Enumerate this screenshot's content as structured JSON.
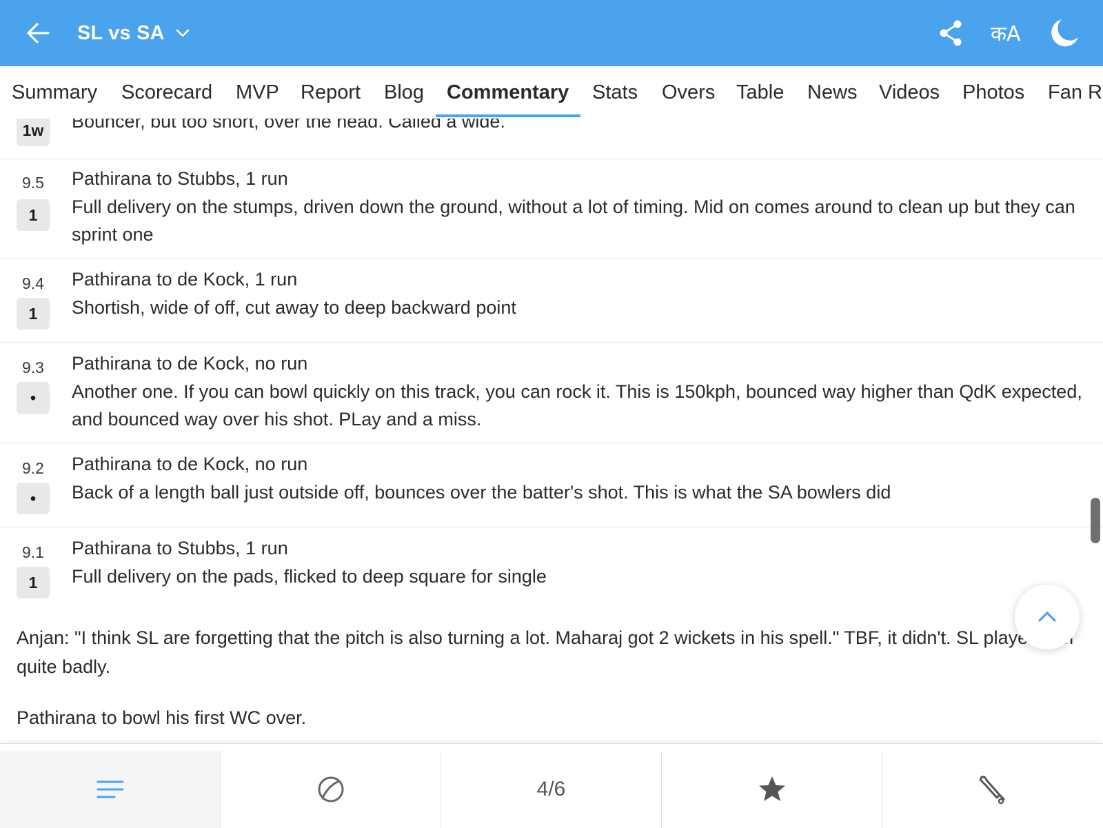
{
  "header": {
    "title": "SL vs SA",
    "icons": [
      "arrow-left-icon",
      "chevron-down-icon",
      "share-icon",
      "language-icon",
      "moon-icon"
    ],
    "background_color": "#4aa3ec",
    "lang_label": "कA"
  },
  "tabs": [
    {
      "label": "Summary"
    },
    {
      "label": "Scorecard"
    },
    {
      "label": "MVP"
    },
    {
      "label": "Report"
    },
    {
      "label": "Blog"
    },
    {
      "label": "Commentary",
      "active": true
    },
    {
      "label": "Stats"
    },
    {
      "label": "Overs"
    },
    {
      "label": "Table"
    },
    {
      "label": "News"
    },
    {
      "label": "Videos"
    },
    {
      "label": "Photos"
    },
    {
      "label": "Fan Ra"
    }
  ],
  "commentary": [
    {
      "badge": "1w",
      "desc": "Bouncer, but too short, over the head. Called a wide."
    },
    {
      "over": "9.5",
      "badge": "1",
      "headline": "Pathirana to Stubbs, 1 run",
      "desc": "Full delivery on the stumps, driven down the ground, without a lot of timing. Mid on comes around to clean up but they can sprint one"
    },
    {
      "over": "9.4",
      "badge": "1",
      "headline": "Pathirana to de Kock, 1 run",
      "desc": "Shortish, wide of off, cut away to deep backward point"
    },
    {
      "over": "9.3",
      "badge": "•",
      "headline": "Pathirana to de Kock, no run",
      "desc": "Another one. If you can bowl quickly on this track, you can rock it. This is 150kph, bounced way higher than QdK expected, and bounced way over his shot. PLay and a miss."
    },
    {
      "over": "9.2",
      "badge": "•",
      "headline": "Pathirana to de Kock, no run",
      "desc": "Back of a length ball just outside off, bounces over the batter's shot. This is what the SA bowlers did"
    },
    {
      "over": "9.1",
      "badge": "1",
      "headline": "Pathirana to Stubbs, 1 run",
      "desc": "Full delivery on the pads, flicked to deep square for single"
    }
  ],
  "notes": [
    "Anjan: \"I think SL are forgetting that the pitch is also turning a lot. Maharaj got 2 wickets in his spell.\" TBF, it didn't. SL played him quite badly.",
    "Pathirana to bowl his first WC over."
  ],
  "scroll_to_top_icon": "chevron-up-icon",
  "bottom_nav": [
    {
      "icon": "menu-lines-icon"
    },
    {
      "icon": "ball-icon"
    },
    {
      "label": "4/6"
    },
    {
      "icon": "star-icon"
    },
    {
      "icon": "cricket-bat-icon"
    }
  ]
}
